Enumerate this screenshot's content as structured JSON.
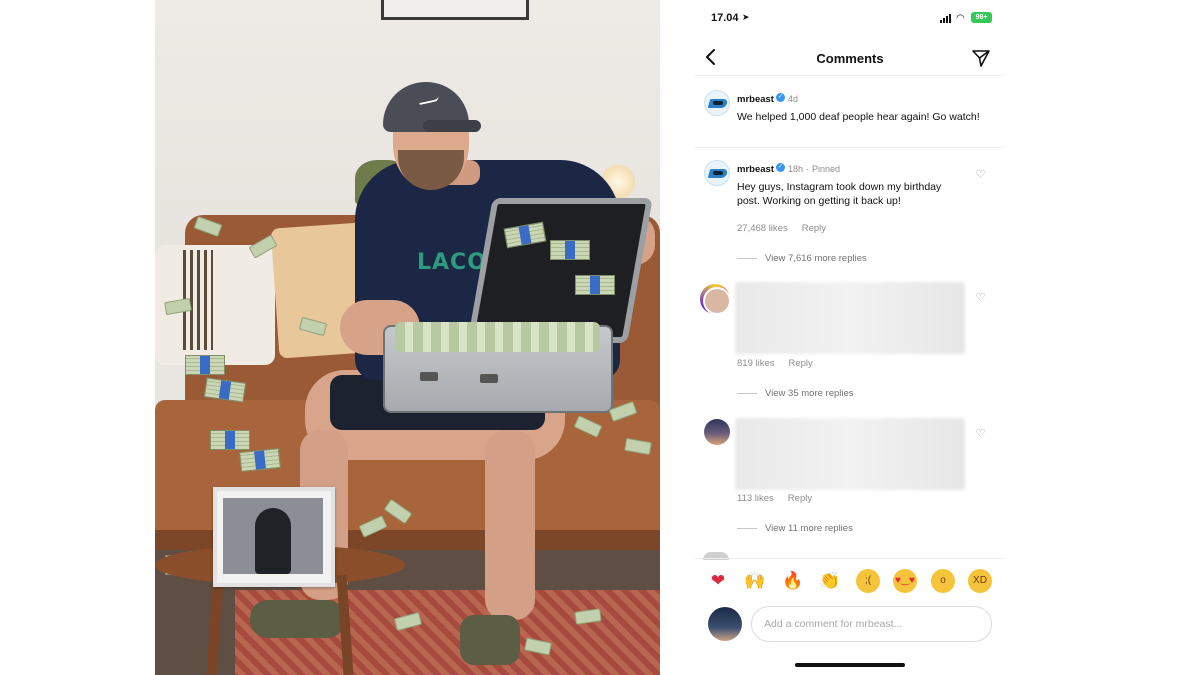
{
  "status_bar": {
    "time": "17.04",
    "battery": "98+"
  },
  "header": {
    "title": "Comments"
  },
  "caption": {
    "username": "mrbeast",
    "time": "4d",
    "text": "We helped 1,000 deaf people hear again! Go watch!"
  },
  "comments": [
    {
      "username": "mrbeast",
      "time": "18h",
      "pinned_label": "Pinned",
      "text": "Hey guys, Instagram took down my birthday post. Working on getting it back up!",
      "likes": "27,468 likes",
      "reply_label": "Reply",
      "view_replies": "View 7,616 more replies"
    },
    {
      "likes": "819 likes",
      "reply_label": "Reply",
      "view_replies": "View 35 more replies"
    },
    {
      "likes": "113 likes",
      "reply_label": "Reply",
      "view_replies": "View 11 more replies"
    }
  ],
  "reactions": [
    "heart",
    "raising-hands",
    "fire",
    "clapping-hands",
    "crying-face",
    "heart-eyes-face",
    "surprised-face",
    "laughing-face"
  ],
  "reaction_glyphs": {
    "heart": "❤",
    "raising-hands": "🙌",
    "fire": "🔥",
    "clapping-hands": "👏",
    "crying-face": ";(",
    "heart-eyes-face": "♥‿♥",
    "surprised-face": "o",
    "laughing-face": "XD"
  },
  "comment_input": {
    "placeholder": "Add a comment for mrbeast..."
  },
  "colors": {
    "verified_blue": "#3797f0",
    "battery_green": "#34c759",
    "heart_red": "#e0293d"
  }
}
